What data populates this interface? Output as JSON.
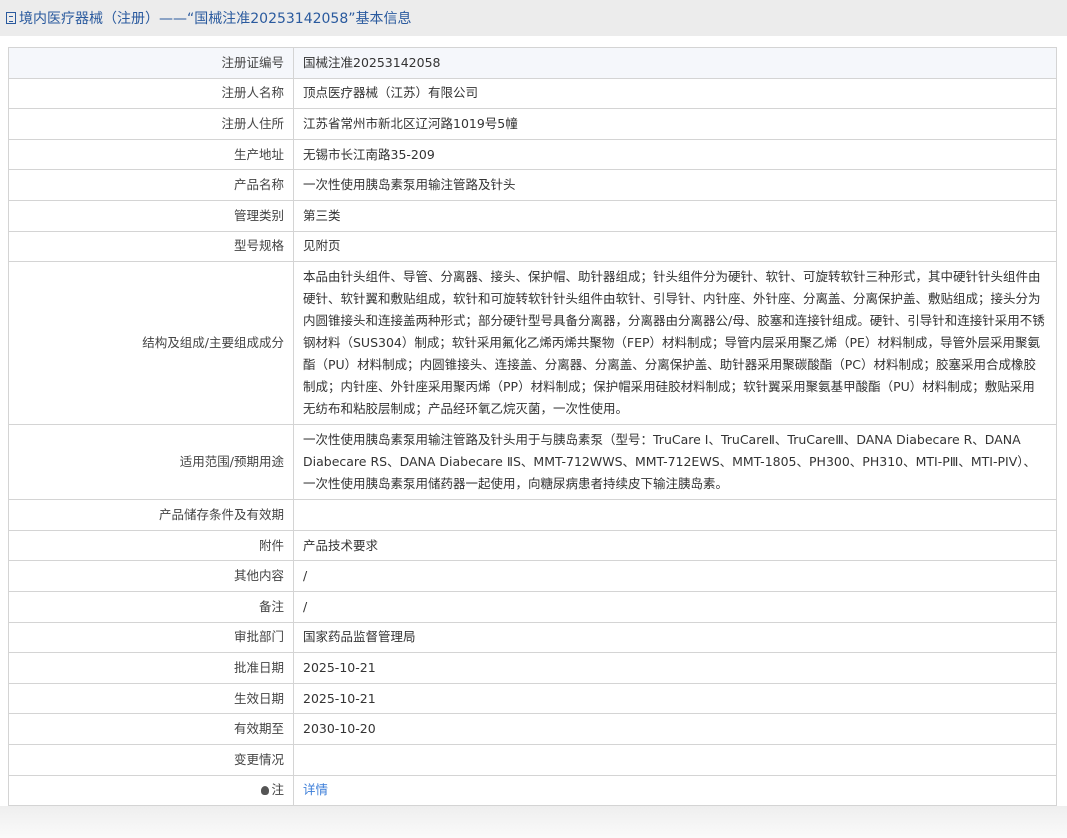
{
  "header": {
    "title": "境内医疗器械（注册）——“国械注准20253142058”基本信息"
  },
  "rows": [
    {
      "label": "注册证编号",
      "value": "国械注准20253142058"
    },
    {
      "label": "注册人名称",
      "value": "顶点医疗器械（江苏）有限公司"
    },
    {
      "label": "注册人住所",
      "value": "江苏省常州市新北区辽河路1019号5幢"
    },
    {
      "label": "生产地址",
      "value": "无锡市长江南路35-209"
    },
    {
      "label": "产品名称",
      "value": "一次性使用胰岛素泵用输注管路及针头"
    },
    {
      "label": "管理类别",
      "value": "第三类"
    },
    {
      "label": "型号规格",
      "value": "见附页"
    },
    {
      "label": "结构及组成/主要组成成分",
      "value": "本品由针头组件、导管、分离器、接头、保护帽、助针器组成；针头组件分为硬针、软针、可旋转软针三种形式，其中硬针针头组件由硬针、软针翼和敷贴组成，软针和可旋转软针针头组件由软针、引导针、内针座、外针座、分离盖、分离保护盖、敷贴组成；接头分为内圆锥接头和连接盖两种形式；部分硬针型号具备分离器，分离器由分离器公/母、胶塞和连接针组成。硬针、引导针和连接针采用不锈钢材料（SUS304）制成；软针采用氟化乙烯丙烯共聚物（FEP）材料制成；导管内层采用聚乙烯（PE）材料制成，导管外层采用聚氨酯（PU）材料制成；内圆锥接头、连接盖、分离器、分离盖、分离保护盖、助针器采用聚碳酸酯（PC）材料制成；胶塞采用合成橡胶制成；内针座、外针座采用聚丙烯（PP）材料制成；保护帽采用硅胶材料制成；软针翼采用聚氨基甲酸酯（PU）材料制成；敷贴采用无纺布和粘胶层制成；产品经环氧乙烷灭菌，一次性使用。"
    },
    {
      "label": "适用范围/预期用途",
      "value": "一次性使用胰岛素泵用输注管路及针头用于与胰岛素泵（型号：TruCare Ⅰ、TruCareⅡ、TruCareⅢ、DANA Diabecare R、DANA Diabecare RS、DANA Diabecare ⅡS、MMT-712WWS、MMT-712EWS、MMT-1805、PH300、PH310、MTI-PⅢ、MTI-PIV）、一次性使用胰岛素泵用储药器一起使用，向糖尿病患者持续皮下输注胰岛素。"
    },
    {
      "label": "产品储存条件及有效期",
      "value": ""
    },
    {
      "label": "附件",
      "value": "产品技术要求"
    },
    {
      "label": "其他内容",
      "value": "/"
    },
    {
      "label": "备注",
      "value": "/"
    },
    {
      "label": "审批部门",
      "value": "国家药品监督管理局"
    },
    {
      "label": "批准日期",
      "value": "2025-10-21"
    },
    {
      "label": "生效日期",
      "value": "2025-10-21"
    },
    {
      "label": "有效期至",
      "value": "2030-10-20"
    },
    {
      "label": "变更情况",
      "value": ""
    }
  ],
  "note": {
    "label": "注",
    "link": "详情"
  }
}
